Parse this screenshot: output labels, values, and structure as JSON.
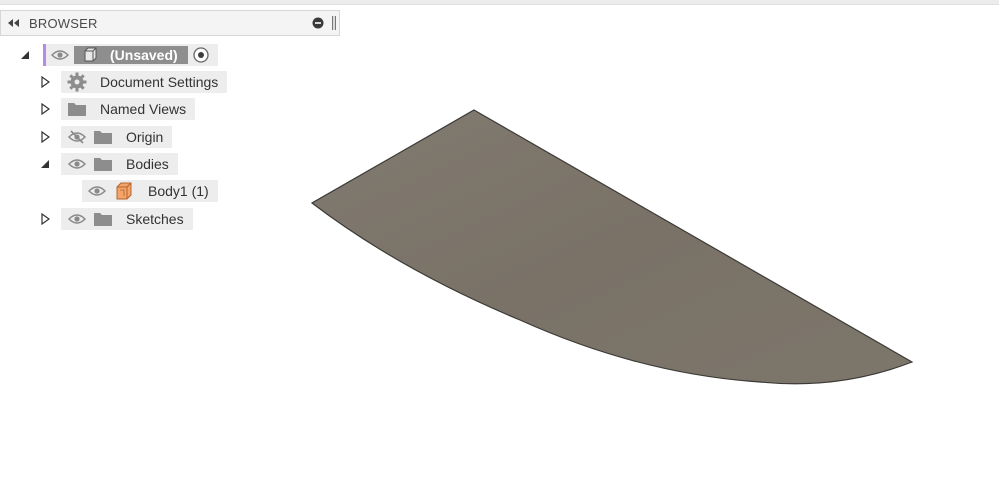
{
  "panel": {
    "title": "BROWSER"
  },
  "tree": {
    "root": {
      "label": "(Unsaved)"
    },
    "items": [
      {
        "label": "Document Settings"
      },
      {
        "label": "Named Views"
      },
      {
        "label": "Origin"
      },
      {
        "label": "Bodies"
      },
      {
        "label": "Body1 (1)"
      },
      {
        "label": "Sketches"
      }
    ]
  },
  "colors": {
    "accent": "#b68be8",
    "shape_fill": "#7c756a",
    "body_icon": "#f2a46a"
  },
  "icons": [
    "collapse-left-icon",
    "minus-circle-icon",
    "pin-icon",
    "eye-icon",
    "eye-hidden-icon",
    "cube-icon",
    "radio-target-icon",
    "gear-icon",
    "folder-icon",
    "body-icon",
    "triangle-expand-icon",
    "triangle-collapse-icon"
  ]
}
